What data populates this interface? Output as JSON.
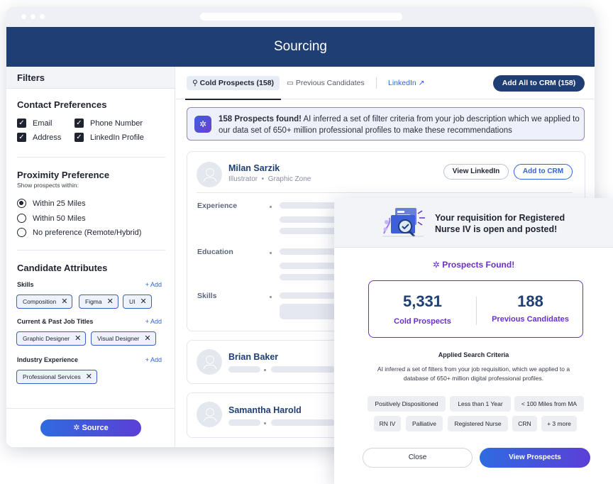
{
  "app": {
    "title": "Sourcing"
  },
  "sidebar": {
    "header": "Filters",
    "contact": {
      "title": "Contact Preferences",
      "options": [
        "Email",
        "Phone Number",
        "Address",
        "LinkedIn Profile"
      ]
    },
    "proximity": {
      "title": "Proximity Preference",
      "subtitle": "Show prospects within:",
      "options": [
        "Within 25 Miles",
        "Within 50 Miles",
        "No preference (Remote/Hybrid)"
      ],
      "selected_index": 0
    },
    "attributes": {
      "title": "Candidate Attributes",
      "add_label": "+ Add",
      "skills_label": "Skills",
      "skills": [
        "Composition",
        "Figma",
        "UI"
      ],
      "titles_label": "Current & Past Job Titles",
      "titles": [
        "Graphic Designer",
        "Visual Designer"
      ],
      "industry_label": "Industry Experience",
      "industry": [
        "Professional Services"
      ]
    },
    "source_button": "Source"
  },
  "main": {
    "tabs": {
      "cold": "Cold Prospects (158)",
      "previous": "Previous Candidates",
      "linkedin": "LinkedIn ↗"
    },
    "add_all_button": "Add All to CRM (158)",
    "banner": {
      "count_text": "158 Prospects found!",
      "body": " AI inferred a set of filter criteria from your job description which we applied to our data set of 650+ million professional profiles to make these recommendations"
    },
    "profile": {
      "name": "Milan Sarzik",
      "role": "Illustrator",
      "company": "Graphic Zone",
      "view_linkedin": "View LinkedIn",
      "add_to_crm": "Add to CRM",
      "experience_label": "Experience",
      "education_label": "Education",
      "skills_label": "Skills"
    },
    "other_profiles": [
      "Brian Baker",
      "Samantha Harold"
    ]
  },
  "modal": {
    "title": "Your requisition for Registered Nurse IV is open and posted!",
    "found_label": "Prospects Found!",
    "cold_count": "5,331",
    "cold_label": "Cold Prospects",
    "prev_count": "188",
    "prev_label": "Previous Candidates",
    "criteria_title": "Applied Search Criteria",
    "criteria_desc": "AI inferred a set of filters from your job requisition, which we applied to a database of 650+ million digital professional profiles.",
    "tags_row1": [
      "Positively Dispositioned",
      "Less than 1 Year",
      "< 100 Miles from MA"
    ],
    "tags_row2": [
      "RN IV",
      "Palliative",
      "Registered Nurse",
      "CRN",
      "+ 3 more"
    ],
    "close_button": "Close",
    "view_button": "View Prospects"
  }
}
